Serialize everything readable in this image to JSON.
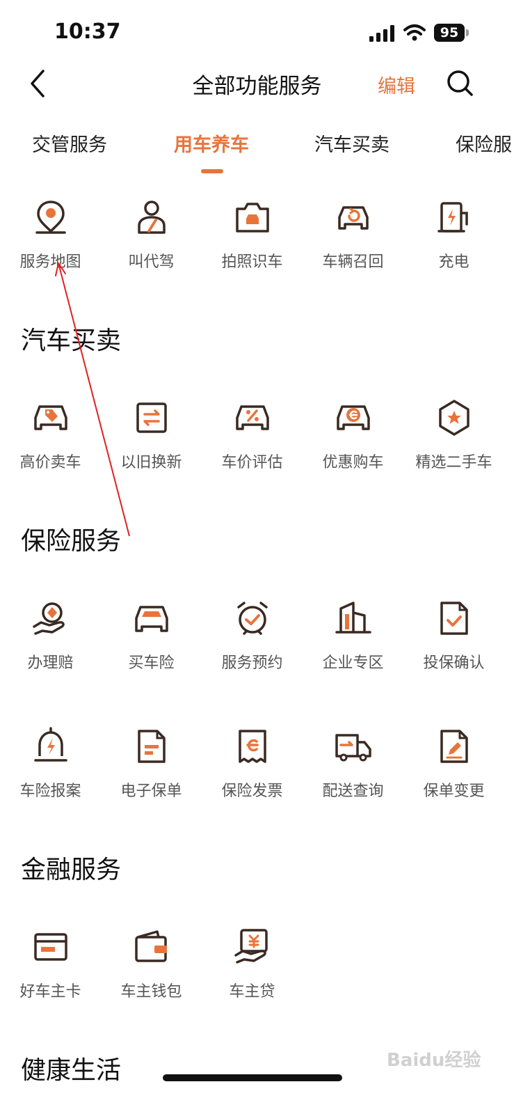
{
  "status_bar": {
    "time": "10:37",
    "battery": "95"
  },
  "header": {
    "title": "全部功能服务",
    "edit_label": "编辑"
  },
  "tabs": [
    {
      "label": "交管服务"
    },
    {
      "label": "用车养车"
    },
    {
      "label": "汽车买卖"
    },
    {
      "label": "保险服"
    }
  ],
  "sections": {
    "car_use": {
      "items": [
        {
          "label": "服务地图",
          "icon": "map-pin-icon"
        },
        {
          "label": "叫代驾",
          "icon": "driver-icon"
        },
        {
          "label": "拍照识车",
          "icon": "camera-car-icon"
        },
        {
          "label": "车辆召回",
          "icon": "car-recall-icon"
        },
        {
          "label": "充电",
          "icon": "charging-icon"
        }
      ]
    },
    "trade": {
      "title": "汽车买卖",
      "items": [
        {
          "label": "高价卖车",
          "icon": "car-tag-icon"
        },
        {
          "label": "以旧换新",
          "icon": "exchange-icon"
        },
        {
          "label": "车价评估",
          "icon": "car-percent-icon"
        },
        {
          "label": "优惠购车",
          "icon": "car-e-icon"
        },
        {
          "label": "精选二手车",
          "icon": "hexagon-star-icon"
        }
      ]
    },
    "insurance": {
      "title": "保险服务",
      "items": [
        {
          "label": "办理赔",
          "icon": "hand-claim-icon"
        },
        {
          "label": "买车险",
          "icon": "car-front-icon"
        },
        {
          "label": "服务预约",
          "icon": "alarm-check-icon"
        },
        {
          "label": "企业专区",
          "icon": "building-icon"
        },
        {
          "label": "投保确认",
          "icon": "doc-check-icon"
        },
        {
          "label": "车险报案",
          "icon": "alarm-bell-icon"
        },
        {
          "label": "电子保单",
          "icon": "doc-lines-icon"
        },
        {
          "label": "保险发票",
          "icon": "receipt-e-icon"
        },
        {
          "label": "配送查询",
          "icon": "truck-icon"
        },
        {
          "label": "保单变更",
          "icon": "doc-edit-icon"
        }
      ]
    },
    "finance": {
      "title": "金融服务",
      "items": [
        {
          "label": "好车主卡",
          "icon": "card-icon"
        },
        {
          "label": "车主钱包",
          "icon": "wallet-icon"
        },
        {
          "label": "车主贷",
          "icon": "loan-icon"
        }
      ]
    },
    "health": {
      "title": "健康生活"
    }
  },
  "watermark": "Baidu经验",
  "colors": {
    "accent": "#e8743b",
    "icon_dark": "#3a2a22",
    "annotation": "#e02020"
  }
}
